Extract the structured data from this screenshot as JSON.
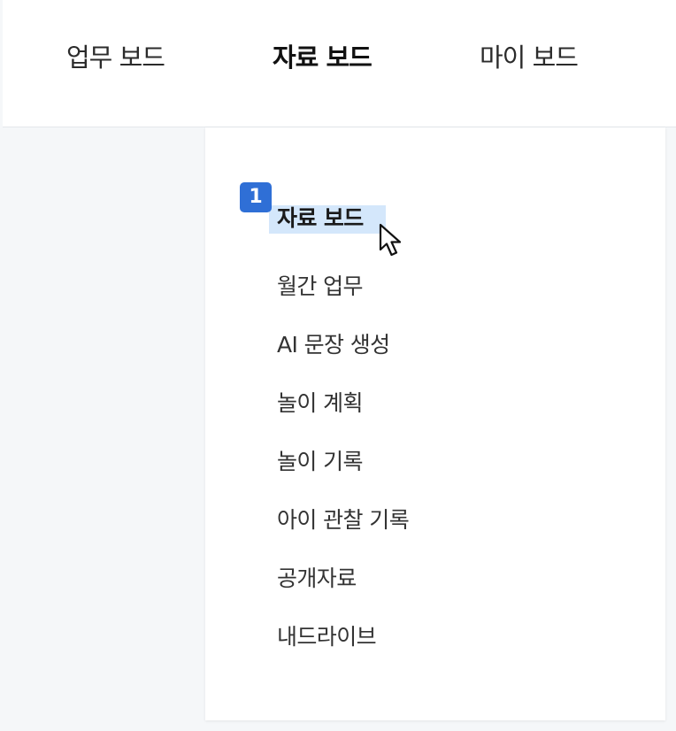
{
  "top_nav": {
    "tabs": [
      {
        "label": "업무 보드",
        "active": false
      },
      {
        "label": "자료 보드",
        "active": true
      },
      {
        "label": "마이 보드",
        "active": false
      }
    ]
  },
  "dropdown": {
    "step_badge": "1",
    "items": [
      {
        "label": "자료 보드",
        "active": true
      },
      {
        "label": "월간 업무"
      },
      {
        "label": "AI 문장 생성"
      },
      {
        "label": "놀이 계획"
      },
      {
        "label": "놀이 기록"
      },
      {
        "label": "아이 관찰 기록"
      },
      {
        "label": "공개자료"
      },
      {
        "label": "내드라이브"
      }
    ]
  },
  "colors": {
    "page_background": "#f5f7f9",
    "highlight": "#d4e7fb",
    "badge": "#2f6fd6",
    "text": "#333333"
  },
  "icons": {
    "cursor": "mouse-pointer-icon"
  }
}
